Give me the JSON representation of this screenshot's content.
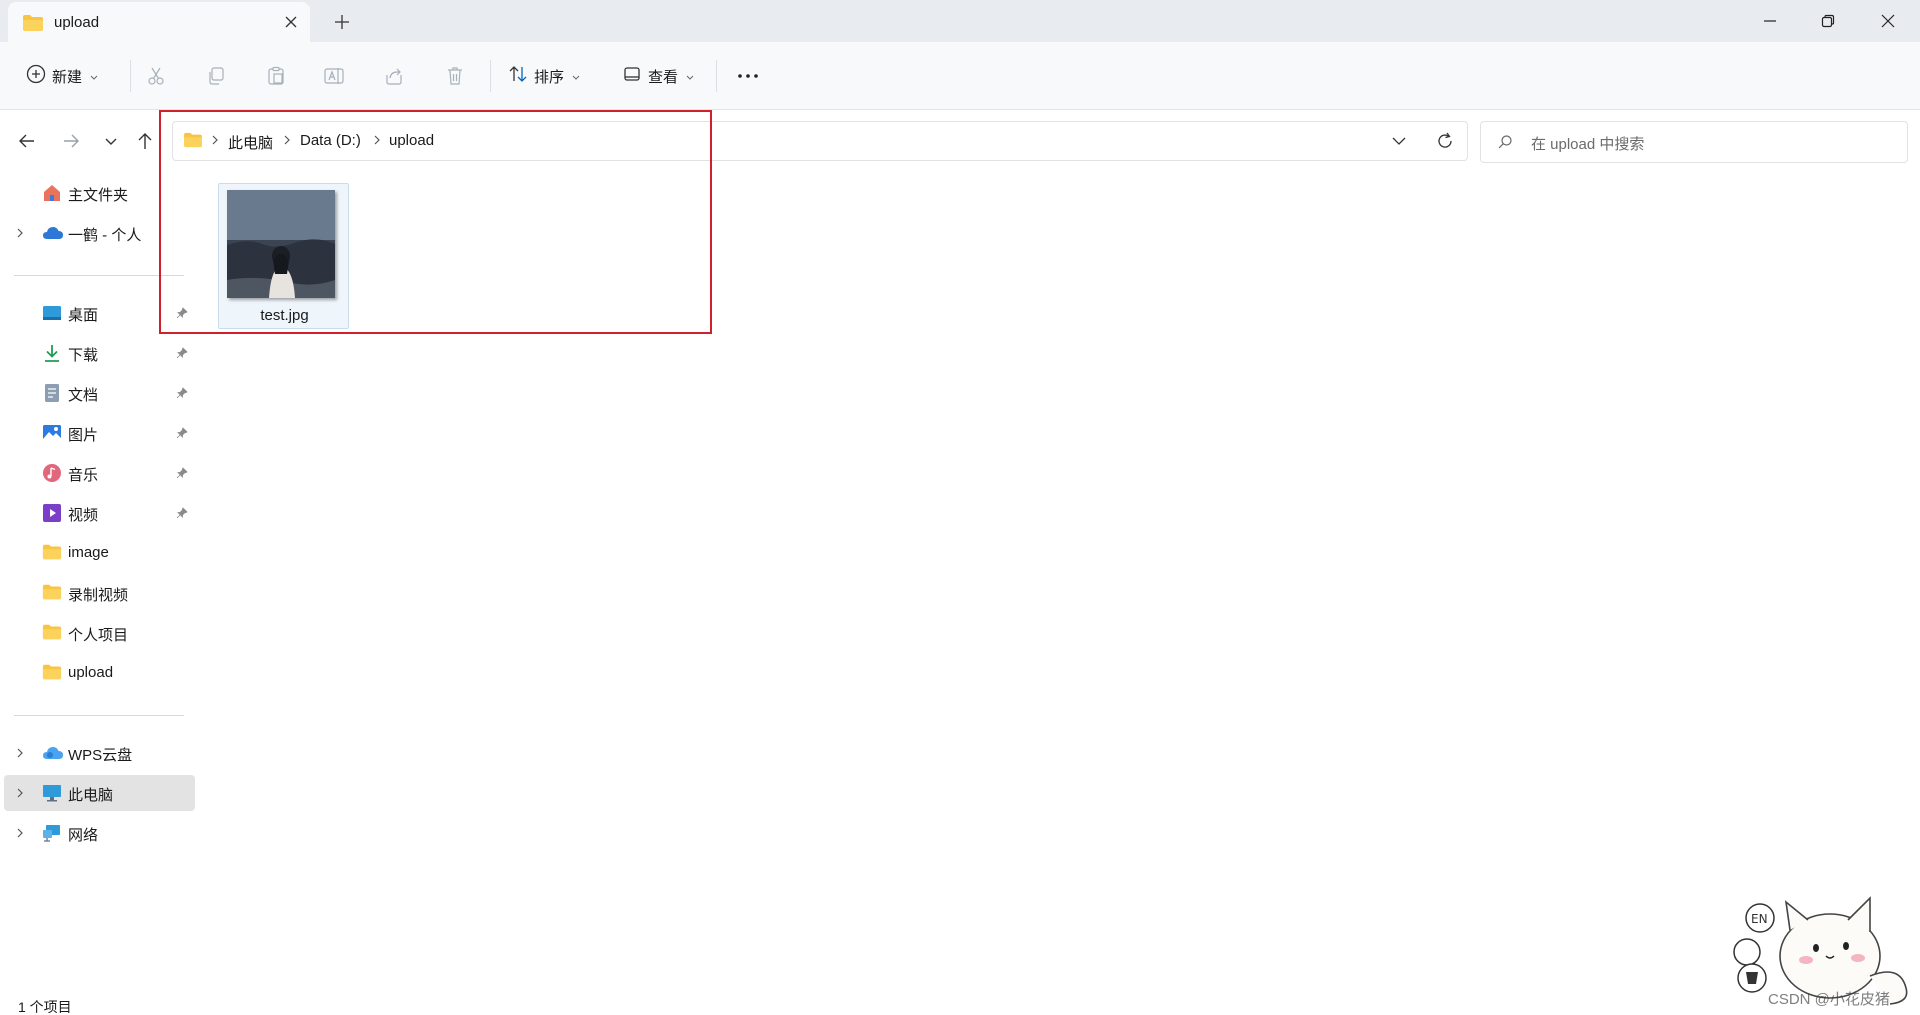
{
  "tab": {
    "title": "upload",
    "new_tab_symbol": "+"
  },
  "window_controls": {
    "minimize": "minimize-icon",
    "restore": "restore-icon",
    "close": "close-icon"
  },
  "toolbar": {
    "new_label": "新建",
    "sort_label": "排序",
    "view_label": "查看",
    "more_symbol": "···"
  },
  "address": {
    "crumbs": [
      "此电脑",
      "Data (D:)",
      "upload"
    ]
  },
  "search": {
    "placeholder": "在 upload 中搜索"
  },
  "sidebar": {
    "items": [
      {
        "label": "主文件夹",
        "icon": "home-icon"
      },
      {
        "label": "一鹤 - 个人",
        "icon": "onedrive-icon"
      },
      {
        "label": "桌面",
        "icon": "desktop-icon"
      },
      {
        "label": "下载",
        "icon": "download-icon"
      },
      {
        "label": "文档",
        "icon": "document-icon"
      },
      {
        "label": "图片",
        "icon": "pictures-icon"
      },
      {
        "label": "音乐",
        "icon": "music-icon"
      },
      {
        "label": "视频",
        "icon": "video-icon"
      },
      {
        "label": "image",
        "icon": "folder-icon"
      },
      {
        "label": "录制视频",
        "icon": "folder-icon"
      },
      {
        "label": "个人项目",
        "icon": "folder-icon"
      },
      {
        "label": "upload",
        "icon": "folder-icon"
      },
      {
        "label": "WPS云盘",
        "icon": "wps-cloud-icon"
      },
      {
        "label": "此电脑",
        "icon": "this-pc-icon"
      },
      {
        "label": "网络",
        "icon": "network-icon"
      }
    ]
  },
  "files": [
    {
      "name": "test.jpg"
    }
  ],
  "status": {
    "count": "1 个项目"
  },
  "watermark": "CSDN @小花皮猪",
  "colors": {
    "accent": "#0067c0",
    "folder": "#f7c443",
    "highlight": "#d0202e",
    "selected": "#e3e3e3"
  }
}
